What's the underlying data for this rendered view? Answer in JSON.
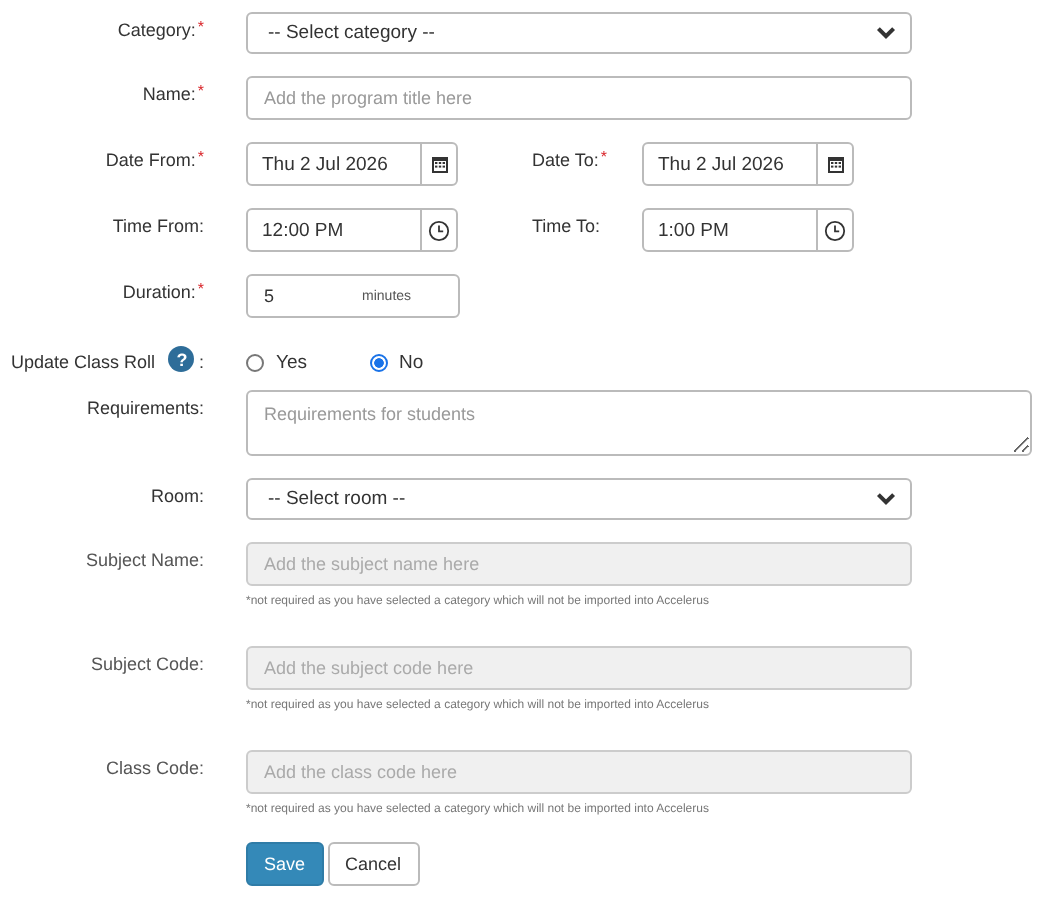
{
  "fields": [
    {
      "kind": "select",
      "label": "Category:",
      "mark": "*",
      "value": "-- Select category --"
    },
    {
      "kind": "text",
      "label": "Name:",
      "mark": "*",
      "placeholder": "Add the program title here",
      "disabled": false
    },
    {
      "kind": "pair",
      "items": [
        {
          "kind": "date",
          "label": "Date From:",
          "mark": "*",
          "value": "Thu 2 Jul 2026"
        },
        {
          "kind": "date",
          "label": "Date To:",
          "mark": "*",
          "value": "Thu 2 Jul 2026"
        }
      ]
    },
    {
      "kind": "pair",
      "items": [
        {
          "kind": "time",
          "label": "Time From:",
          "value": "12:00 PM"
        },
        {
          "kind": "time",
          "label": "Time To:",
          "value": "1:00 PM"
        }
      ]
    },
    {
      "kind": "number",
      "label": "Duration:",
      "mark": "*",
      "value": "5",
      "unit": "minutes"
    },
    {
      "kind": "radio",
      "label": "Update Class Roll",
      "help": "?",
      "suffix": ":",
      "options": [
        {
          "label": "Yes",
          "selected": false
        },
        {
          "label": "No",
          "selected": true
        }
      ]
    },
    {
      "kind": "textarea",
      "label": "Requirements:",
      "placeholder": "Requirements for students",
      "disabled": false
    },
    {
      "kind": "select",
      "label": "Room:",
      "value": "-- Select room --"
    },
    {
      "kind": "text",
      "label": "Subject Name:",
      "placeholder": "Add the subject name here",
      "disabled": true,
      "note": "*not required as you have selected a category which will not be imported into Accelerus"
    },
    {
      "kind": "text",
      "label": "Subject Code:",
      "placeholder": "Add the subject code here",
      "disabled": true,
      "note": "*not required as you have selected a category which will not be imported into Accelerus"
    },
    {
      "kind": "text",
      "label": "Class Code:",
      "placeholder": "Add the class code here",
      "disabled": true,
      "note": "*not required as you have selected a category which will not be imported into Accelerus"
    }
  ],
  "buttons": [
    {
      "label": "Save",
      "kind": "primary"
    },
    {
      "label": "Cancel",
      "kind": "default"
    }
  ]
}
